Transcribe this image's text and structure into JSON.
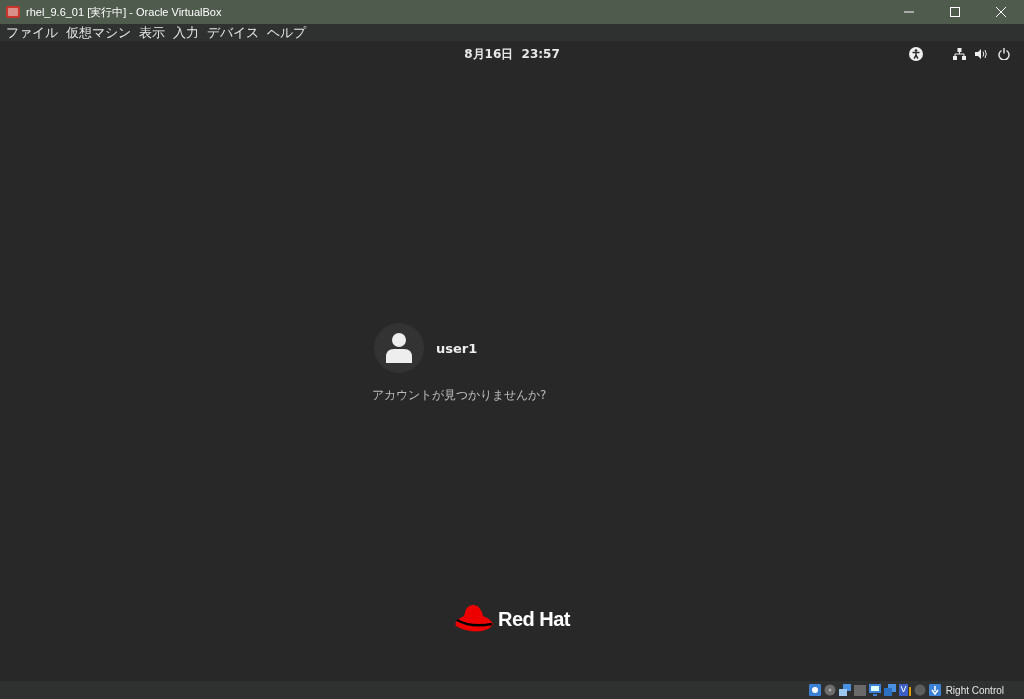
{
  "window": {
    "title": "rhel_9.6_01 [実行中] - Oracle VirtualBox"
  },
  "menu": [
    "ファイル",
    "仮想マシン",
    "表示",
    "入力",
    "デバイス",
    "ヘルプ"
  ],
  "top_bar": {
    "clock": "8月16日  23:57"
  },
  "login": {
    "user": "user1",
    "not_listed": "アカウントが見つかりませんか?"
  },
  "logo": {
    "text": "Red Hat"
  },
  "status_bar": {
    "host_key": "Right Control"
  }
}
